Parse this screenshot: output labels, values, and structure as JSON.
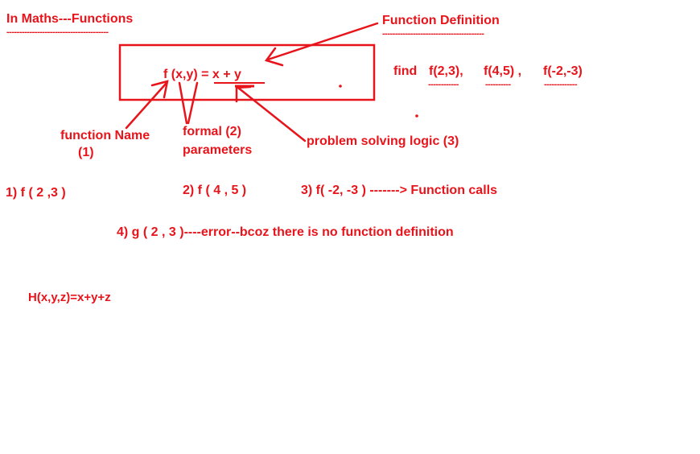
{
  "title": "In Maths---Functions",
  "definition_label": "Function Definition",
  "formula": "f (x,y) = x + y",
  "find": {
    "label": "find",
    "calls": [
      "f(2,3),",
      "f(4,5) ,",
      "f(-2,-3)"
    ]
  },
  "labels": {
    "function_name": "function Name",
    "function_name_num": "(1)",
    "formal_line1": "formal  (2)",
    "formal_line2": "parameters",
    "logic": "problem solving logic (3)"
  },
  "calls_row": {
    "c1": "1)  f ( 2 ,3 )",
    "c2": "2) f ( 4 , 5 )",
    "c3": "3) f( -2, -3 ) -------> Function calls"
  },
  "error_line": "4)  g ( 2 , 3 )----error--bcoz there is no function definition",
  "extra_formula": "H(x,y,z)=x+y+z",
  "colors": {
    "ink": "#e8141b",
    "background": "#ffffff"
  }
}
